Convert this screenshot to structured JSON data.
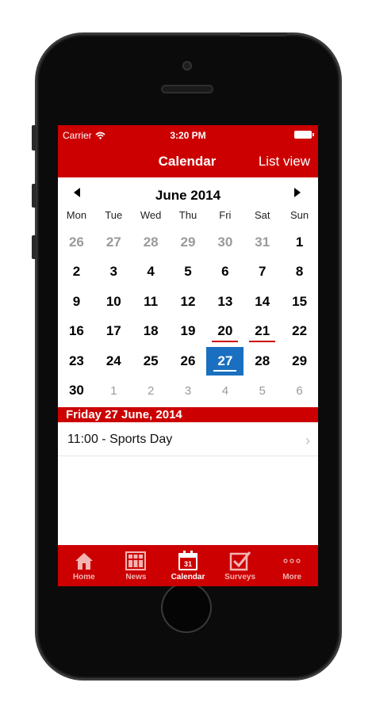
{
  "status": {
    "carrier": "Carrier",
    "time": "3:20 PM"
  },
  "navbar": {
    "title": "Calendar",
    "right_action": "List view"
  },
  "calendar": {
    "month_title": "June 2014",
    "weekdays": [
      "Mon",
      "Tue",
      "Wed",
      "Thu",
      "Fri",
      "Sat",
      "Sun"
    ],
    "weeks": [
      [
        {
          "d": "26",
          "m": true
        },
        {
          "d": "27",
          "m": true
        },
        {
          "d": "28",
          "m": true
        },
        {
          "d": "29",
          "m": true
        },
        {
          "d": "30",
          "m": true
        },
        {
          "d": "31",
          "m": true
        },
        {
          "d": "1"
        }
      ],
      [
        {
          "d": "2"
        },
        {
          "d": "3"
        },
        {
          "d": "4"
        },
        {
          "d": "5"
        },
        {
          "d": "6"
        },
        {
          "d": "7"
        },
        {
          "d": "8"
        }
      ],
      [
        {
          "d": "9"
        },
        {
          "d": "10"
        },
        {
          "d": "11"
        },
        {
          "d": "12"
        },
        {
          "d": "13"
        },
        {
          "d": "14"
        },
        {
          "d": "15"
        }
      ],
      [
        {
          "d": "16"
        },
        {
          "d": "17"
        },
        {
          "d": "18"
        },
        {
          "d": "19"
        },
        {
          "d": "20",
          "e": true
        },
        {
          "d": "21",
          "e": true
        },
        {
          "d": "22"
        }
      ],
      [
        {
          "d": "23"
        },
        {
          "d": "24"
        },
        {
          "d": "25"
        },
        {
          "d": "26"
        },
        {
          "d": "27",
          "s": true
        },
        {
          "d": "28"
        },
        {
          "d": "29"
        }
      ],
      [
        {
          "d": "30"
        },
        {
          "d": "1",
          "m": true,
          "n": true
        },
        {
          "d": "2",
          "m": true,
          "n": true
        },
        {
          "d": "3",
          "m": true,
          "n": true
        },
        {
          "d": "4",
          "m": true,
          "n": true
        },
        {
          "d": "5",
          "m": true,
          "n": true
        },
        {
          "d": "6",
          "m": true,
          "n": true
        }
      ]
    ]
  },
  "selected_day": {
    "header": "Friday 27 June, 2014",
    "events": [
      {
        "text": "11:00 - Sports Day"
      }
    ]
  },
  "tabs": [
    {
      "label": "Home",
      "icon": "house-icon",
      "active": false
    },
    {
      "label": "News",
      "icon": "grid-icon",
      "active": false
    },
    {
      "label": "Calendar",
      "icon": "calendar-icon",
      "icon_text": "31",
      "active": true
    },
    {
      "label": "Surveys",
      "icon": "checkbox-icon",
      "active": false
    },
    {
      "label": "More",
      "icon": "more-dots-icon",
      "active": false
    }
  ],
  "colors": {
    "brand_red": "#cc0000",
    "selected_blue": "#1a6fc0"
  }
}
